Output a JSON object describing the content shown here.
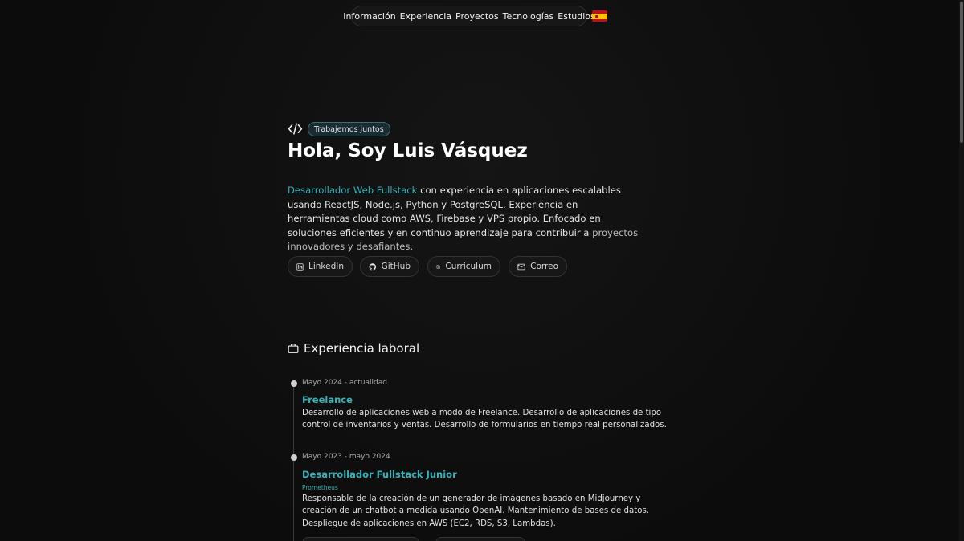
{
  "nav": {
    "items": [
      "Información",
      "Experiencia",
      "Proyectos",
      "Tecnologías",
      "Estudios"
    ],
    "language_flag": "spain-flag-icon"
  },
  "hero": {
    "badge": "Trabajemos juntos",
    "title": "Hola, Soy Luis Vásquez",
    "desc_accent": "Desarrollador Web Fullstack",
    "desc_main": " con experiencia en aplicaciones escalables usando ReactJS, Node.js, Python y PostgreSQL. Experiencia en herramientas cloud como AWS, Firebase y VPS propio. Enfocado en soluciones eficientes y en continuo aprendizaje para contribuir a ",
    "desc_soft": "proyectos innovadores y desafiantes.",
    "links": [
      {
        "label": "LinkedIn",
        "icon": "linkedin-icon"
      },
      {
        "label": "GitHub",
        "icon": "github-icon"
      },
      {
        "label": "Curriculum",
        "icon": "document-icon"
      },
      {
        "label": "Correo",
        "icon": "mail-icon"
      }
    ]
  },
  "experience": {
    "title": "Experiencia laboral",
    "items": [
      {
        "date": "Mayo 2024 - actualidad",
        "role": "Freelance",
        "company": "",
        "description": "Desarrollo de aplicaciones web a modo de Freelance. Desarrollo de aplicaciones de tipo control de inventarios y ventas. Desarrollo de formularios en tiempo real personalizados."
      },
      {
        "date": "Mayo 2023 - mayo 2024",
        "role": "Desarrollador Fullstack Junior",
        "company": "Prometheus",
        "description": "Responsable de la creación de un generador de imágenes basado en Midjourney y creación de un chatbot a medida usando OpenAI. Mantenimiento de bases de datos. Despliegue de aplicaciones en AWS (EC2, RDS, S3, Lambdas)."
      }
    ]
  },
  "colors": {
    "background": "#0e0e0e",
    "accent": "#35b2b8",
    "text": "#e8e8e8"
  }
}
